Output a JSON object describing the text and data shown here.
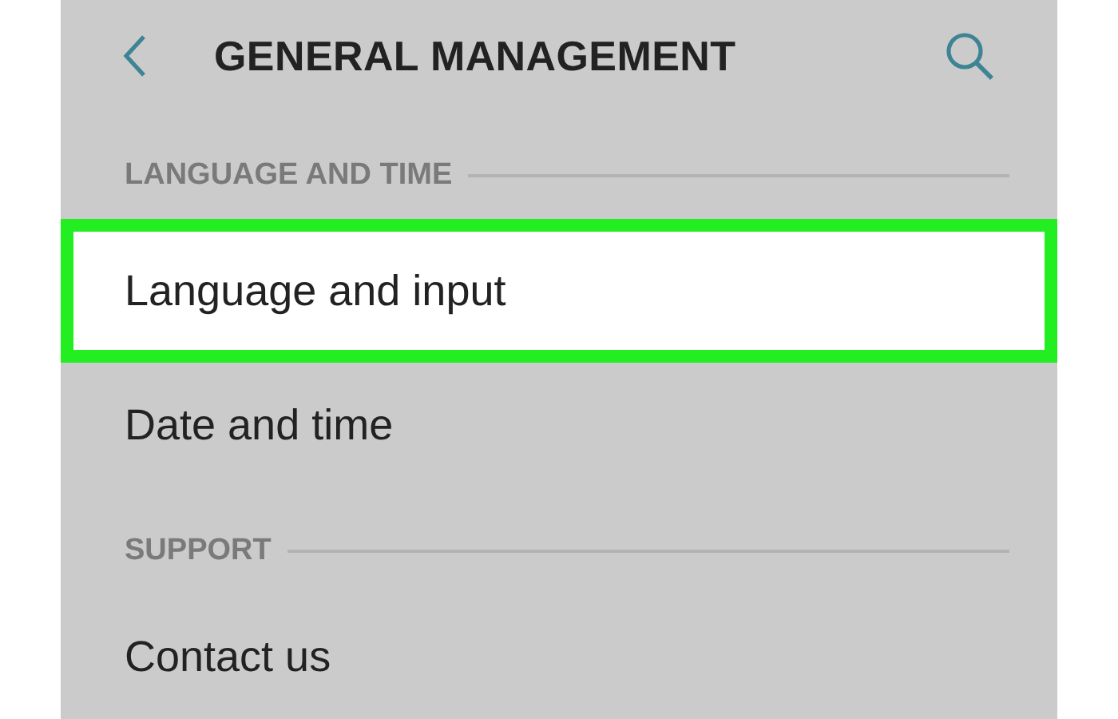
{
  "header": {
    "title": "GENERAL MANAGEMENT"
  },
  "sections": [
    {
      "title": "LANGUAGE AND TIME",
      "items": [
        {
          "label": "Language and input",
          "highlighted": true
        },
        {
          "label": "Date and time",
          "highlighted": false
        }
      ]
    },
    {
      "title": "SUPPORT",
      "items": [
        {
          "label": "Contact us",
          "highlighted": false
        }
      ]
    }
  ]
}
